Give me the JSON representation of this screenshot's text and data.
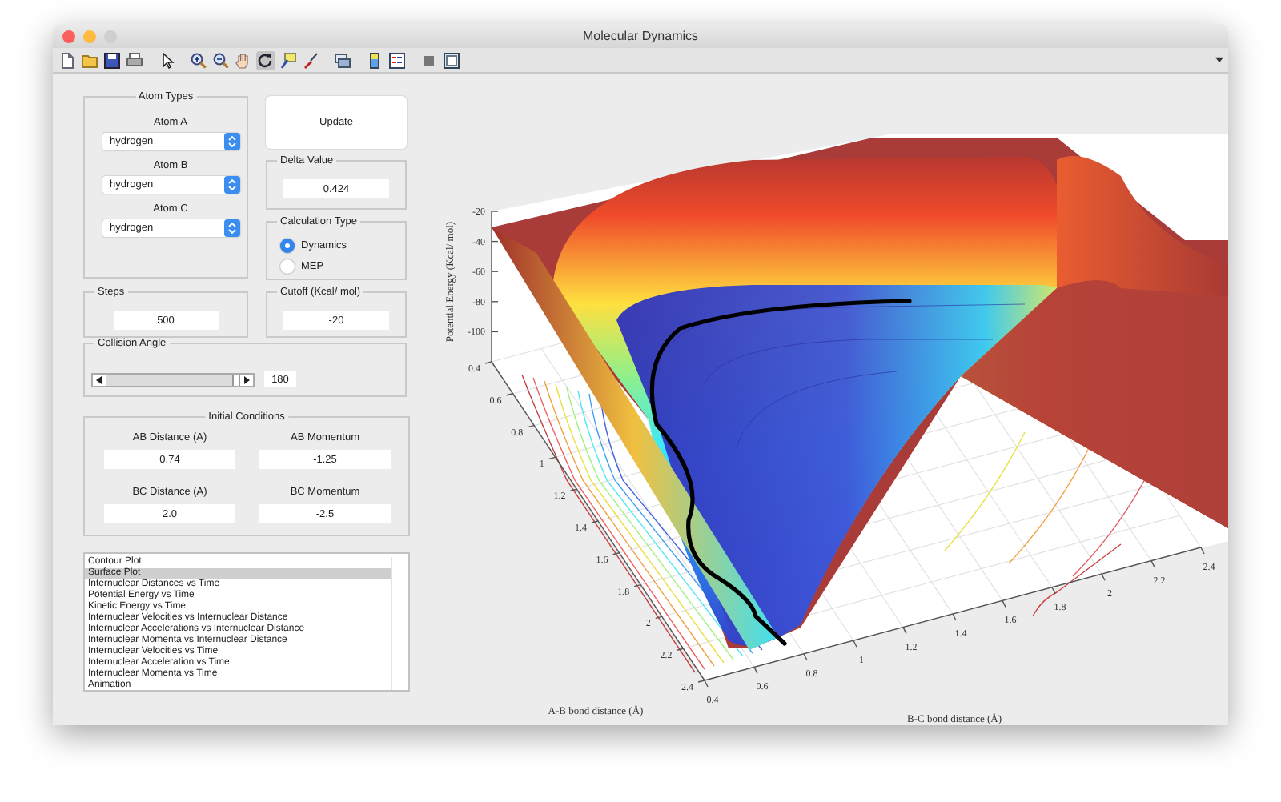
{
  "window": {
    "title": "Molecular Dynamics"
  },
  "toolbar": [
    {
      "kind": "new",
      "selected": false
    },
    {
      "kind": "open",
      "selected": false
    },
    {
      "kind": "save",
      "selected": false
    },
    {
      "kind": "print",
      "selected": false
    },
    {
      "kind": "pointer",
      "selected": false
    },
    {
      "kind": "zoom-in",
      "selected": false
    },
    {
      "kind": "zoom-out",
      "selected": false
    },
    {
      "kind": "pan",
      "selected": false
    },
    {
      "kind": "rotate",
      "selected": true
    },
    {
      "kind": "data-cursor",
      "selected": false
    },
    {
      "kind": "brush",
      "selected": false
    },
    {
      "kind": "link",
      "selected": false
    },
    {
      "kind": "colorbar",
      "selected": false
    },
    {
      "kind": "legend",
      "selected": false
    },
    {
      "kind": "hide-tools",
      "selected": false
    },
    {
      "kind": "show-tools",
      "selected": false
    }
  ],
  "atom_types": {
    "title": "Atom Types",
    "atoms": [
      {
        "label": "Atom A",
        "value": "hydrogen"
      },
      {
        "label": "Atom B",
        "value": "hydrogen"
      },
      {
        "label": "Atom C",
        "value": "hydrogen"
      }
    ]
  },
  "update_button": "Update",
  "delta_value": {
    "title": "Delta Value",
    "value": "0.424"
  },
  "calculation_type": {
    "title": "Calculation Type",
    "options": [
      {
        "label": "Dynamics",
        "selected": true
      },
      {
        "label": "MEP",
        "selected": false
      }
    ]
  },
  "steps": {
    "title": "Steps",
    "value": "500"
  },
  "cutoff": {
    "title": "Cutoff (Kcal/ mol)",
    "value": "-20"
  },
  "collision_angle": {
    "title": "Collision Angle",
    "level": 1,
    "value": "180"
  },
  "initial_conditions": {
    "title": "Initial Conditions",
    "fields": [
      {
        "label": "AB Distance (A)",
        "value": "0.74"
      },
      {
        "label": "AB Momentum",
        "value": "-1.25"
      },
      {
        "label": "BC Distance (A)",
        "value": "2.0"
      },
      {
        "label": "BC Momentum",
        "value": "-2.5"
      }
    ]
  },
  "plot_list": [
    {
      "label": "Contour Plot",
      "selected": false
    },
    {
      "label": "Surface Plot",
      "selected": true
    },
    {
      "label": "Internuclear Distances vs Time",
      "selected": false
    },
    {
      "label": "Potential Energy vs Time",
      "selected": false
    },
    {
      "label": "Kinetic Energy vs Time",
      "selected": false
    },
    {
      "label": "Internuclear Velocities vs Internuclear Distance",
      "selected": false
    },
    {
      "label": "Internuclear Accelerations vs Internuclear Distance",
      "selected": false
    },
    {
      "label": "Internuclear Momenta vs Internuclear Distance",
      "selected": false
    },
    {
      "label": "Internuclear Velocities vs Time",
      "selected": false
    },
    {
      "label": "Internuclear Acceleration vs Time",
      "selected": false
    },
    {
      "label": "Internuclear Momenta vs Time",
      "selected": false
    },
    {
      "label": "Animation",
      "selected": false
    }
  ],
  "plot": {
    "zlabel": "Potential Energy (Kcal/ mol)",
    "xlabel": "A-B bond distance (Å)",
    "ylabel": "B-C bond distance (Å)",
    "zticks": [
      "-20",
      "-40",
      "-60",
      "-80",
      "-100"
    ],
    "xticks": [
      "0.4",
      "0.6",
      "0.8",
      "1",
      "1.2",
      "1.4",
      "1.6",
      "1.8",
      "2",
      "2.2",
      "2.4"
    ],
    "yticks": [
      "0.4",
      "0.6",
      "0.8",
      "1",
      "1.2",
      "1.4",
      "1.6",
      "1.8",
      "2",
      "2.2",
      "2.4"
    ]
  }
}
